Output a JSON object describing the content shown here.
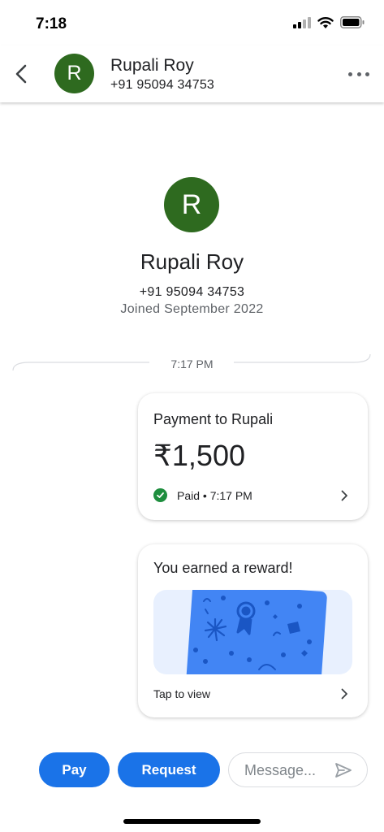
{
  "status_bar": {
    "time": "7:18"
  },
  "header": {
    "avatar_letter": "R",
    "name": "Rupali Roy",
    "phone": "+91 95094 34753"
  },
  "profile": {
    "avatar_letter": "R",
    "name": "Rupali Roy",
    "phone": "+91 95094 34753",
    "joined": "Joined September 2022"
  },
  "conversation": {
    "divider_time": "7:17 PM",
    "payment_card": {
      "title": "Payment to Rupali",
      "amount": "₹1,500",
      "status": "Paid • 7:17 PM"
    },
    "reward_card": {
      "title": "You earned a reward!",
      "action": "Tap to view"
    }
  },
  "bottom_bar": {
    "pay_label": "Pay",
    "request_label": "Request",
    "message_placeholder": "Message..."
  },
  "colors": {
    "accent": "#1a73e8",
    "avatar": "#2e6a1f",
    "paid_check": "#1e8e3e",
    "reward_background": "#e8f0fe",
    "reward_card": "#4285f4"
  },
  "icons": {
    "back": "back-arrow-icon",
    "more": "more-horizontal-icon",
    "paid": "check-circle-icon",
    "chevron": "chevron-right-icon",
    "send": "send-icon"
  }
}
